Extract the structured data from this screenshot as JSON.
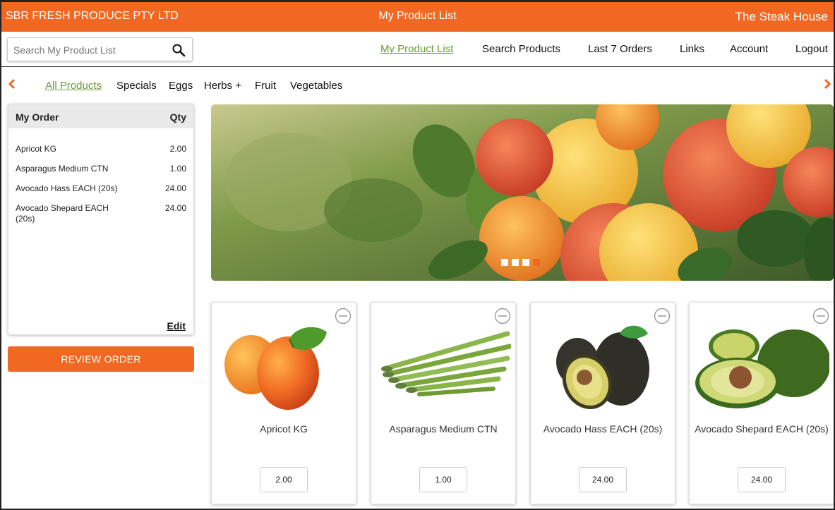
{
  "header": {
    "company": "SBR FRESH PRODUCE PTY LTD",
    "page_title": "My Product List",
    "customer": "The Steak House",
    "brand_color": "#f16822"
  },
  "search": {
    "placeholder": "Search My Product List",
    "value": ""
  },
  "main_nav": [
    {
      "label": "My Product List",
      "active": true
    },
    {
      "label": "Search Products",
      "active": false
    },
    {
      "label": "Last 7 Orders",
      "active": false
    },
    {
      "label": "Links",
      "active": false
    },
    {
      "label": "Account",
      "active": false
    },
    {
      "label": "Logout",
      "active": false
    }
  ],
  "categories": [
    {
      "label": "All Products",
      "active": true
    },
    {
      "label": "Specials",
      "active": false
    },
    {
      "label": "Eggs",
      "active": false
    },
    {
      "label": "Herbs +",
      "active": false
    },
    {
      "label": "Fruit",
      "active": false
    },
    {
      "label": "Vegetables",
      "active": false
    }
  ],
  "order": {
    "title": "My Order",
    "qty_header": "Qty",
    "items": [
      {
        "name": "Apricot KG",
        "qty": "2.00"
      },
      {
        "name": "Asparagus Medium CTN",
        "qty": "1.00"
      },
      {
        "name": "Avocado Hass EACH (20s)",
        "qty": "24.00"
      },
      {
        "name": "Avocado Shepard EACH (20s)",
        "qty": "24.00"
      }
    ],
    "edit_label": "Edit",
    "review_label": "REVIEW ORDER"
  },
  "banner": {
    "slide_count": 4,
    "active_slide": 4
  },
  "products": [
    {
      "name": "Apricot KG",
      "qty": "2.00",
      "icon": "apricot-image"
    },
    {
      "name": "Asparagus Medium CTN",
      "qty": "1.00",
      "icon": "asparagus-image"
    },
    {
      "name": "Avocado Hass EACH (20s)",
      "qty": "24.00",
      "icon": "avocado-hass-image"
    },
    {
      "name": "Avocado Shepard EACH (20s)",
      "qty": "24.00",
      "icon": "avocado-shepard-image"
    }
  ],
  "colors": {
    "accent": "#f16822",
    "active_link": "#6a9a3a"
  }
}
